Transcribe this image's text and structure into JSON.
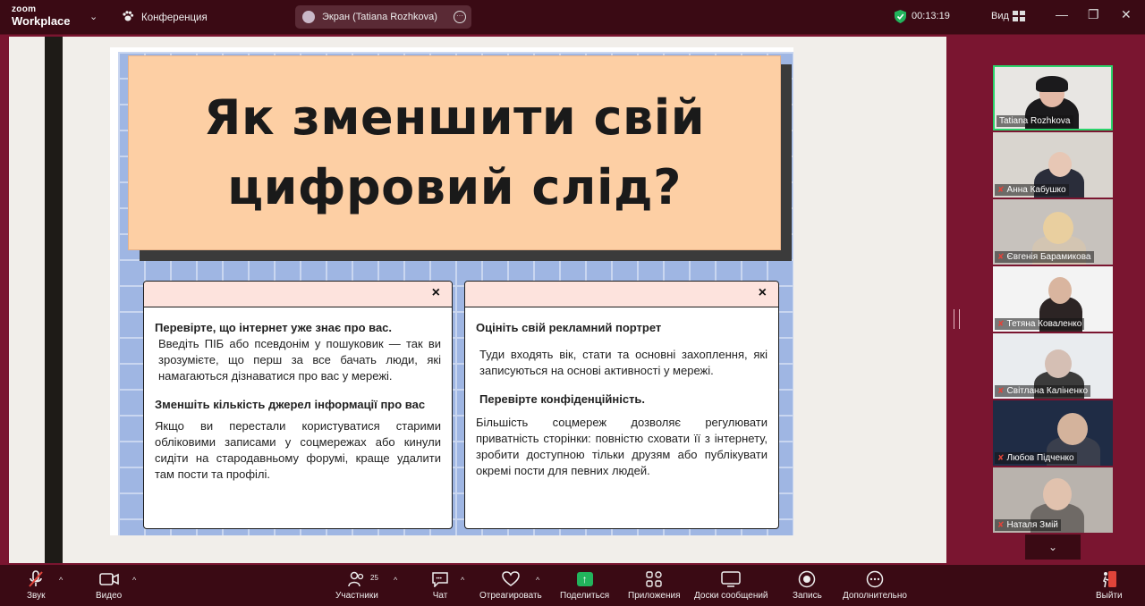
{
  "app": {
    "logo_top": "zoom",
    "logo_bottom": "Workplace",
    "meeting_name": "Конференция"
  },
  "share": {
    "label": "Экран (Tatiana Rozhkova)"
  },
  "status": {
    "timer": "00:13:19",
    "view_label": "Вид"
  },
  "slide": {
    "title_line1": "Як зменшити свій",
    "title_line2": "цифровий слід?",
    "left_card": {
      "heading1": "Перевірте, що інтернет уже знає про вас.",
      "text1": "Введіть ПІБ або псевдонім у пошуковик — так ви зрозумієте, що перш за все бачать люди, які намагаються дізнаватися про вас у мережі.",
      "heading2": "Зменшіть кількість джерел інформації про вас",
      "text2": "Якщо ви перестали користуватися старими обліковими записами у соцмережах або кинули сидіти на стародавньому форумі, краще удалити там пости та профілі."
    },
    "right_card": {
      "heading1": "Оцініть свій рекламний портрет",
      "text1": "Туди входять вік, стати та основні захоплення, які записуються на основі активності у мережі.",
      "heading2": "Перевірте конфіденційність.",
      "text2": "Більшість соцмереж дозволяє регулювати приватність сторінки: повністю сховати її з інтернету, зробити доступною тільки друзям або публікувати окремі пости для певних людей."
    },
    "close_glyph": "×"
  },
  "participants": [
    {
      "name": "Tatiana Rozhkova",
      "muted": false,
      "active": true
    },
    {
      "name": "Анна Кабушко",
      "muted": true,
      "active": false
    },
    {
      "name": "Євгенія Барамикова",
      "muted": true,
      "active": false
    },
    {
      "name": "Тетяна  Коваленко",
      "muted": true,
      "active": false
    },
    {
      "name": "Світлана Каліненко",
      "muted": true,
      "active": false
    },
    {
      "name": "Любов Підченко",
      "muted": true,
      "active": false
    },
    {
      "name": "Наталя Змій",
      "muted": true,
      "active": false
    }
  ],
  "toolbar": {
    "audio": "Звук",
    "video": "Видео",
    "participants": "Участники",
    "participants_count": "25",
    "chat": "Чат",
    "react": "Отреагировать",
    "share": "Поделиться",
    "apps": "Приложения",
    "whiteboards": "Доски сообщений",
    "record": "Запись",
    "more": "Дополнительно",
    "leave": "Выйти"
  },
  "colors": {
    "accent_green": "#22b35c",
    "bar_bg": "#3a0a14",
    "page_bg": "#7a1530",
    "title_bg": "#fdcfa4"
  }
}
